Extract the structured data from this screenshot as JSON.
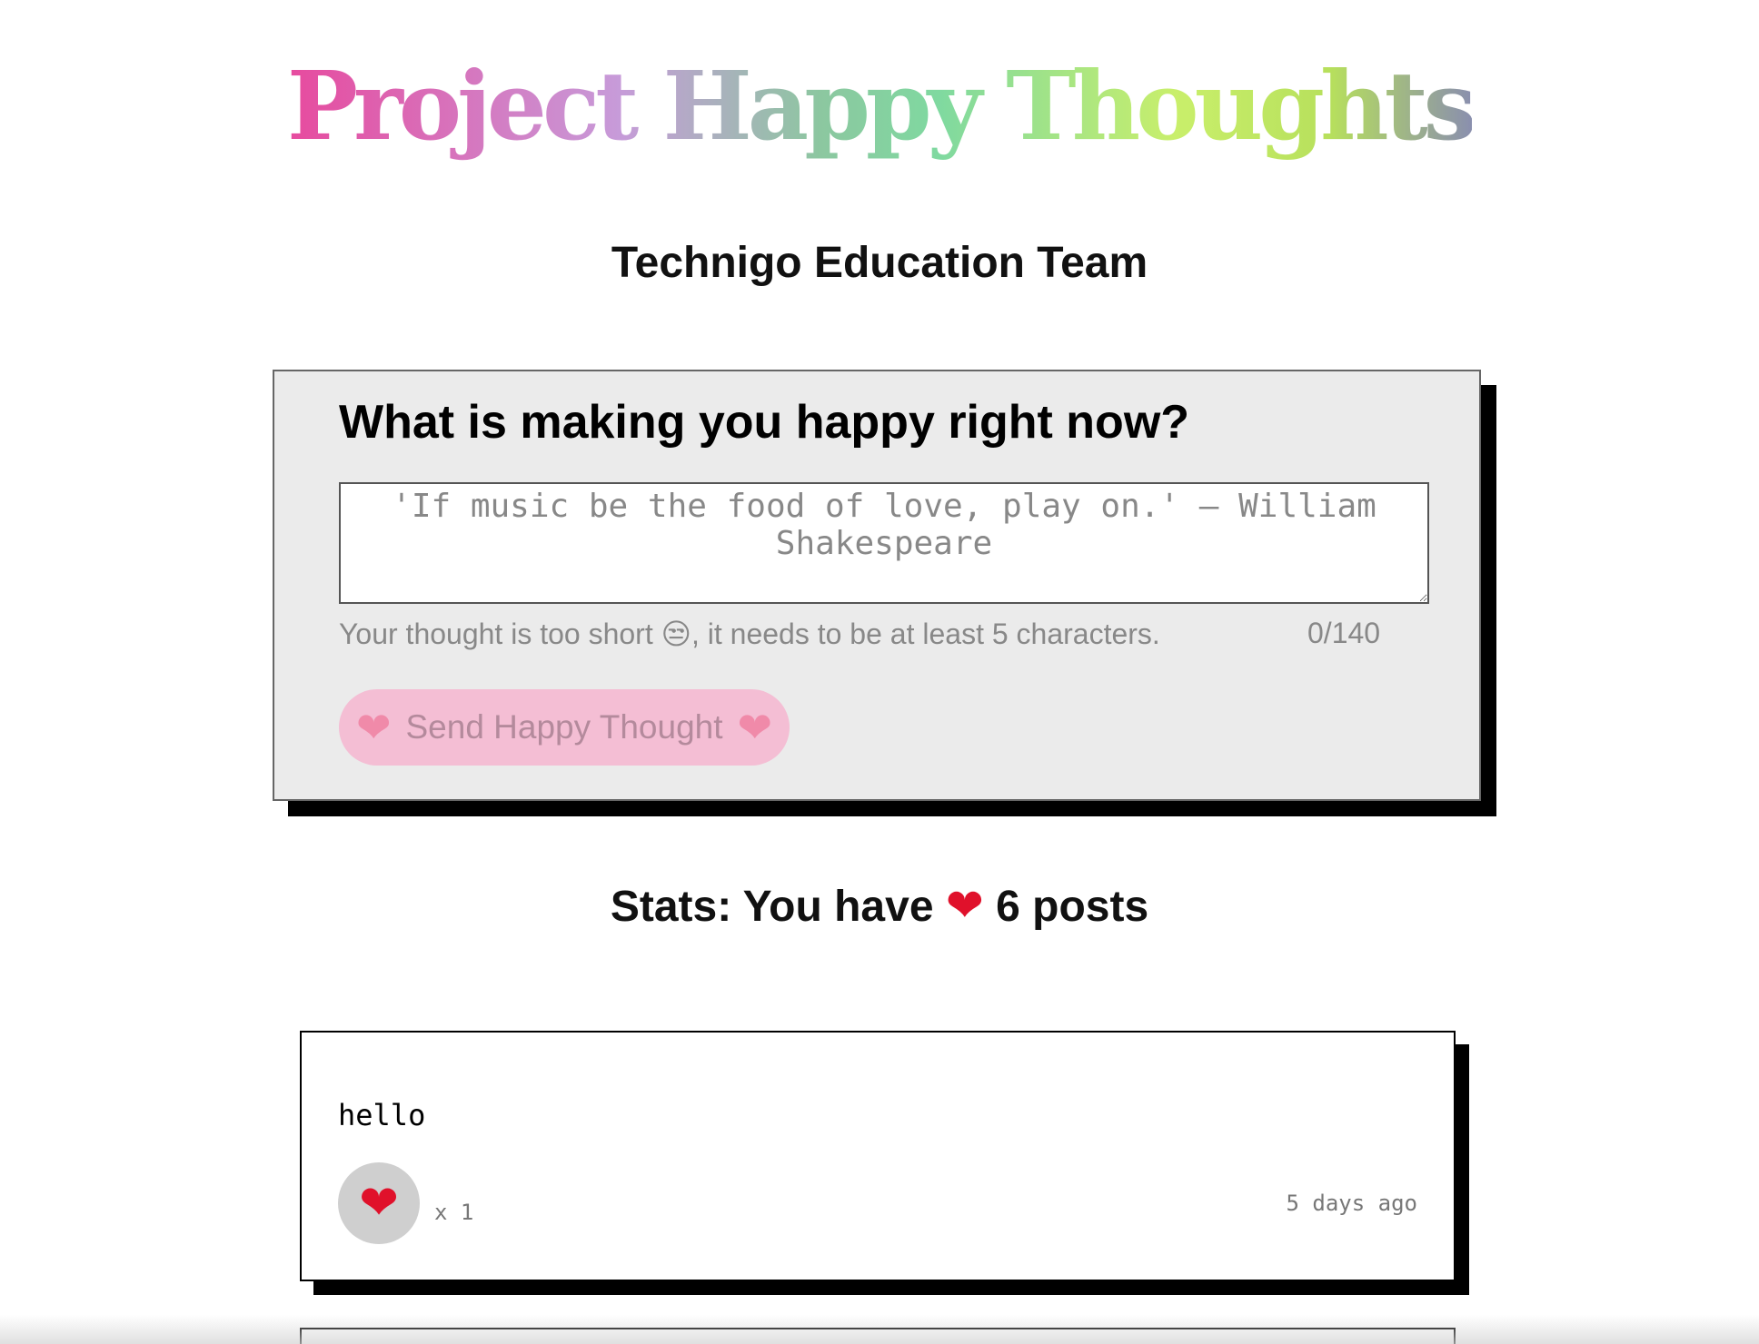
{
  "header": {
    "title": "Project Happy Thoughts",
    "team": "Technigo Education Team"
  },
  "form": {
    "heading": "What is making you happy right now?",
    "placeholder": "'If music be the food of love, play on.' — William Shakespeare",
    "value": "",
    "error_text": "Your thought is too short 😒, it needs to be at least 5 characters.",
    "counter": "0/140",
    "button_label": "Send Happy Thought",
    "button_disabled": true
  },
  "stats": {
    "prefix": "Stats: You have",
    "suffix": "6 posts"
  },
  "posts": [
    {
      "text": "hello",
      "likes": "x 1",
      "time": "5 days ago"
    }
  ]
}
